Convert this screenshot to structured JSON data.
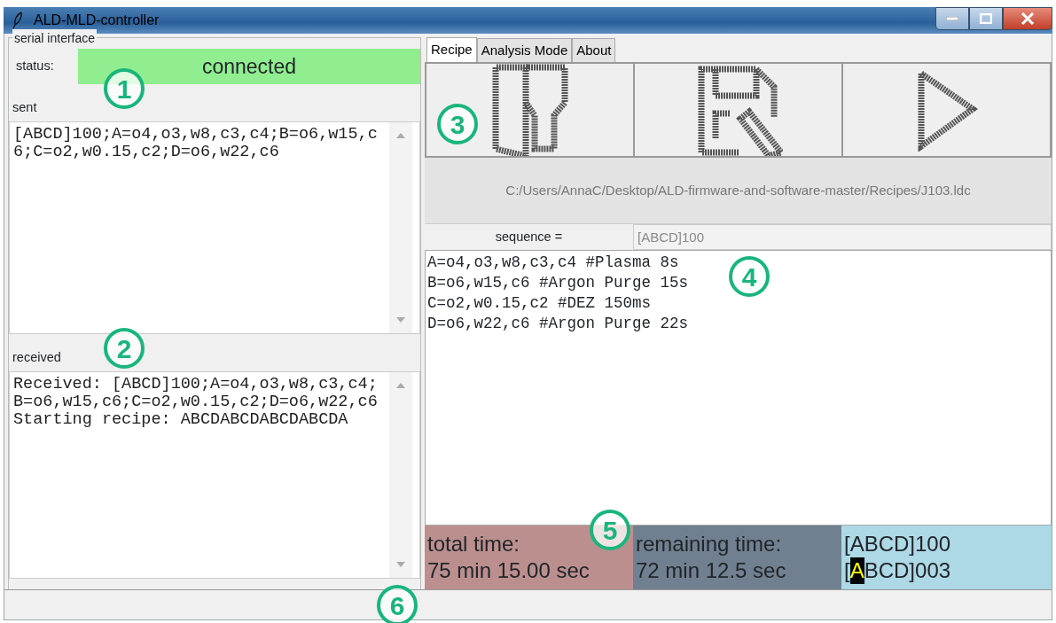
{
  "window": {
    "title": "ALD-MLD-controller"
  },
  "serial_interface": {
    "title": "serial interface",
    "status_label": "status:",
    "status": "connected",
    "connected": true,
    "sent_label": "sent",
    "sent": "[ABCD]100;A=o4,o3,w8,c3,c4;B=o6,w15,c6;C=o2,w0.15,c2;D=o6,w22,c6",
    "received_label": "received",
    "received": "Received: [ABCD]100;A=o4,o3,w8,c3,c4;B=o6,w15,c6;C=o2,w0.15,c2;D=o6,w22,c6\nStarting recipe: ABCDABCDABCDABCDA"
  },
  "tabs": [
    {
      "label": "Recipe",
      "selected": true
    },
    {
      "label": "Analysis Mode",
      "selected": false
    },
    {
      "label": "About",
      "selected": false
    }
  ],
  "recipe": {
    "file_path": "C:/Users/AnnaC/Desktop/ALD-firmware-and-software-master/Recipes/J103.ldc",
    "sequence_label": "sequence =",
    "sequence": "[ABCD]100",
    "lines": [
      "A=o4,o3,w8,c3,c4 #Plasma 8s",
      "B=o6,w15,c6 #Argon Purge 15s",
      "C=o2,w0.15,c2 #DEZ 150ms",
      "D=o6,w22,c6 #Argon Purge 22s"
    ],
    "total_time_label": "total time:",
    "total_time": "75 min 15.00 sec",
    "remaining_time_label": "remaining time:",
    "remaining_time": "72 min 12.5 sec",
    "progress_sequence": "[ABCD]100",
    "progress": [
      {
        "text": "[",
        "highlighted": false
      },
      {
        "text": "A",
        "highlighted": true
      },
      {
        "text": "BCD]003",
        "highlighted": false
      }
    ]
  },
  "callouts": [
    "1",
    "2",
    "3",
    "4",
    "5",
    "6"
  ]
}
